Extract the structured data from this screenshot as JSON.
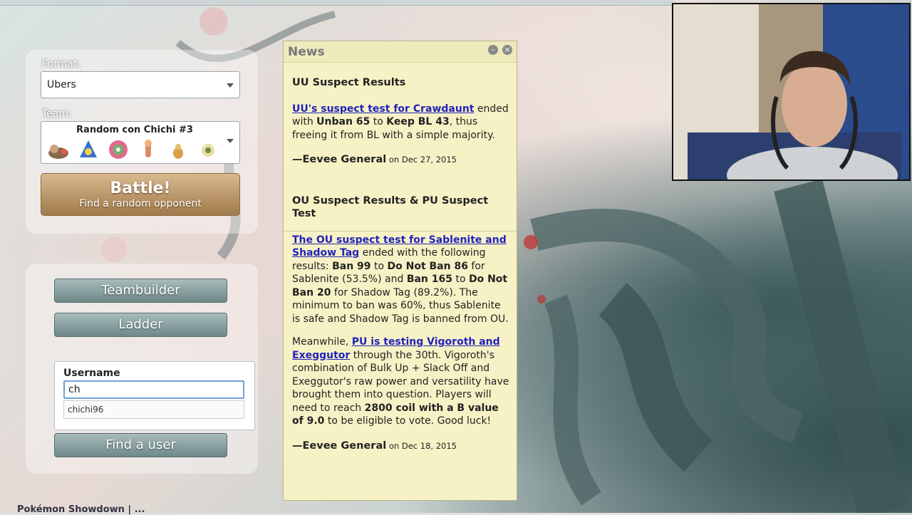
{
  "left": {
    "format_label": "Format:",
    "format_value": "Ubers",
    "team_label": "Team:",
    "team_value": "Random con Chichi #3",
    "team_sprites": [
      "pokemon-1-icon",
      "pokemon-2-icon",
      "pokemon-3-icon",
      "pokemon-4-icon",
      "pokemon-5-icon",
      "pokemon-6-icon"
    ],
    "battle_label": "Battle!",
    "battle_sub": "Find a random opponent",
    "teambuilder_label": "Teambuilder",
    "ladder_label": "Ladder",
    "username_label": "Username",
    "username_value": "ch",
    "suggestion": "chichi96",
    "find_user_label": "Find a user"
  },
  "news": {
    "title": "News",
    "items": [
      {
        "title": "UU Suspect Results",
        "link": "UU's suspect test for Crawdaunt",
        "text_1": " ended with ",
        "b1": "Unban 65",
        "text_2": " to ",
        "b2": "Keep BL 43",
        "text_3": ", thus freeing it from BL with a simple majority.",
        "author": "—Eevee General",
        "date_prefix": " on ",
        "date": "Dec 27, 2015"
      },
      {
        "title": "OU Suspect Results & PU Suspect Test",
        "link": "The OU suspect test for Sablenite and Shadow Tag",
        "t1": " ended with the following results: ",
        "b1": "Ban 99",
        "t2": " to ",
        "b2": "Do Not Ban 86",
        "t3": " for Sablenite (53.5%) and ",
        "b3": "Ban 165",
        "t4": " to ",
        "b4": "Do Not Ban 20",
        "t5": " for Shadow Tag (89.2%). The minimum to ban was 60%, thus Sablenite is safe and Shadow Tag is banned from OU.",
        "p2_t1": "Meanwhile, ",
        "p2_link": "PU is testing Vigoroth and Exeggutor",
        "p2_t2": " through the 30th. Vigoroth's combination of Bulk Up + Slack Off and Exeggutor's raw power and versatility have brought them into question. Players will need to reach ",
        "p2_b1": "2800 coil with a B value of 9.0",
        "p2_t3": " to be eligible to vote. Good luck!",
        "author": "—Eevee General",
        "date_prefix": " on ",
        "date": "Dec 18, 2015"
      }
    ]
  },
  "bottom_text": "Pokémon Showdown | ..."
}
